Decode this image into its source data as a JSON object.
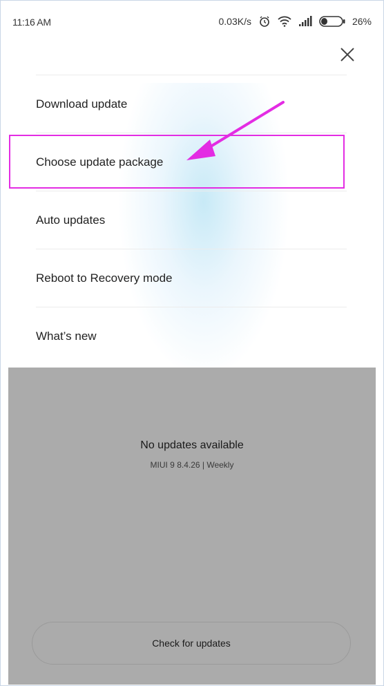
{
  "status_bar": {
    "time": "11:16 AM",
    "net_speed": "0.03K/s",
    "battery": "26%"
  },
  "menu": {
    "items": [
      {
        "label": "Download update"
      },
      {
        "label": "Choose update package"
      },
      {
        "label": "Auto updates"
      },
      {
        "label": "Reboot to Recovery mode"
      },
      {
        "label": "What’s new"
      }
    ]
  },
  "update_status": {
    "title": "No updates available",
    "version": "MIUI 9 8.4.26 | Weekly"
  },
  "check_button": {
    "label": "Check for updates"
  },
  "colors": {
    "highlight": "#e32ce3",
    "panel": "#ababab"
  },
  "icons": [
    "alarm-icon",
    "wifi-icon",
    "signal-icon",
    "battery-icon",
    "close-icon",
    "arrow-annotation"
  ]
}
